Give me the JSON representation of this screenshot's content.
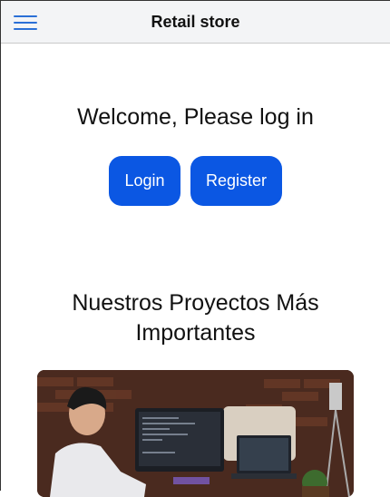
{
  "header": {
    "menu_icon": "hamburger-menu-icon",
    "title": "Retail store"
  },
  "main": {
    "welcome": "Welcome, Please log in",
    "login_label": "Login",
    "register_label": "Register",
    "projects_title": "Nuestros Proyectos Más Importantes"
  },
  "colors": {
    "primary": "#0b57e3",
    "menu_icon": "#2b6fd6",
    "header_bg": "#f3f4f6"
  }
}
